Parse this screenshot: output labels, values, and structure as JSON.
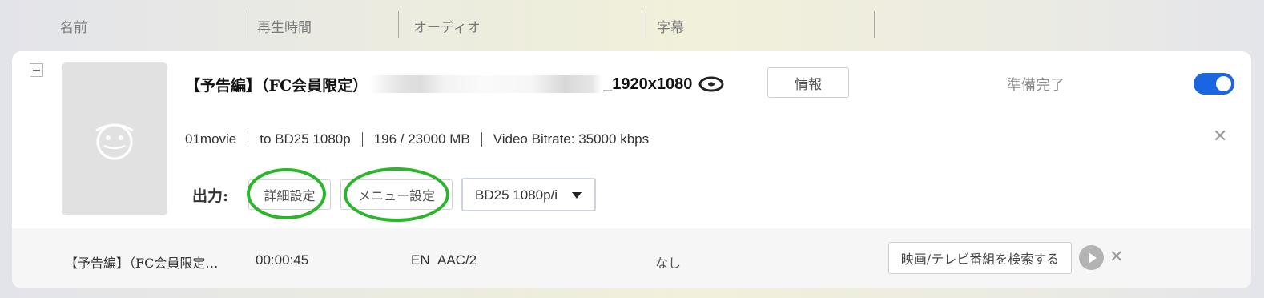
{
  "header": {
    "columns": [
      "名前",
      "再生時間",
      "オーディオ",
      "字幕"
    ]
  },
  "item": {
    "title_prefix": "【予告編】（FC会員限定）",
    "title_suffix": "_1920x1080",
    "disc_icon": "bluray-disc-icon",
    "info_label": "情報",
    "status": "準備完了",
    "enabled": true,
    "meta": [
      "01movie",
      "to BD25 1080p",
      "196 / 23000 MB",
      "Video Bitrate: 35000 kbps"
    ],
    "output": {
      "label": "出力:",
      "advanced_settings": "詳細設定",
      "menu_settings": "メニュー設定",
      "format_selected": "BD25 1080p/i"
    }
  },
  "track": {
    "name": "【予告編】（FC会員限定…",
    "duration": "00:00:45",
    "audio_lang": "EN",
    "audio_codec": "AAC/2",
    "subtitle": "なし",
    "search_label": "映画/テレビ番組を検索する"
  },
  "colors": {
    "accent": "#1a66e0",
    "highlight_ring": "#2bb52b"
  }
}
